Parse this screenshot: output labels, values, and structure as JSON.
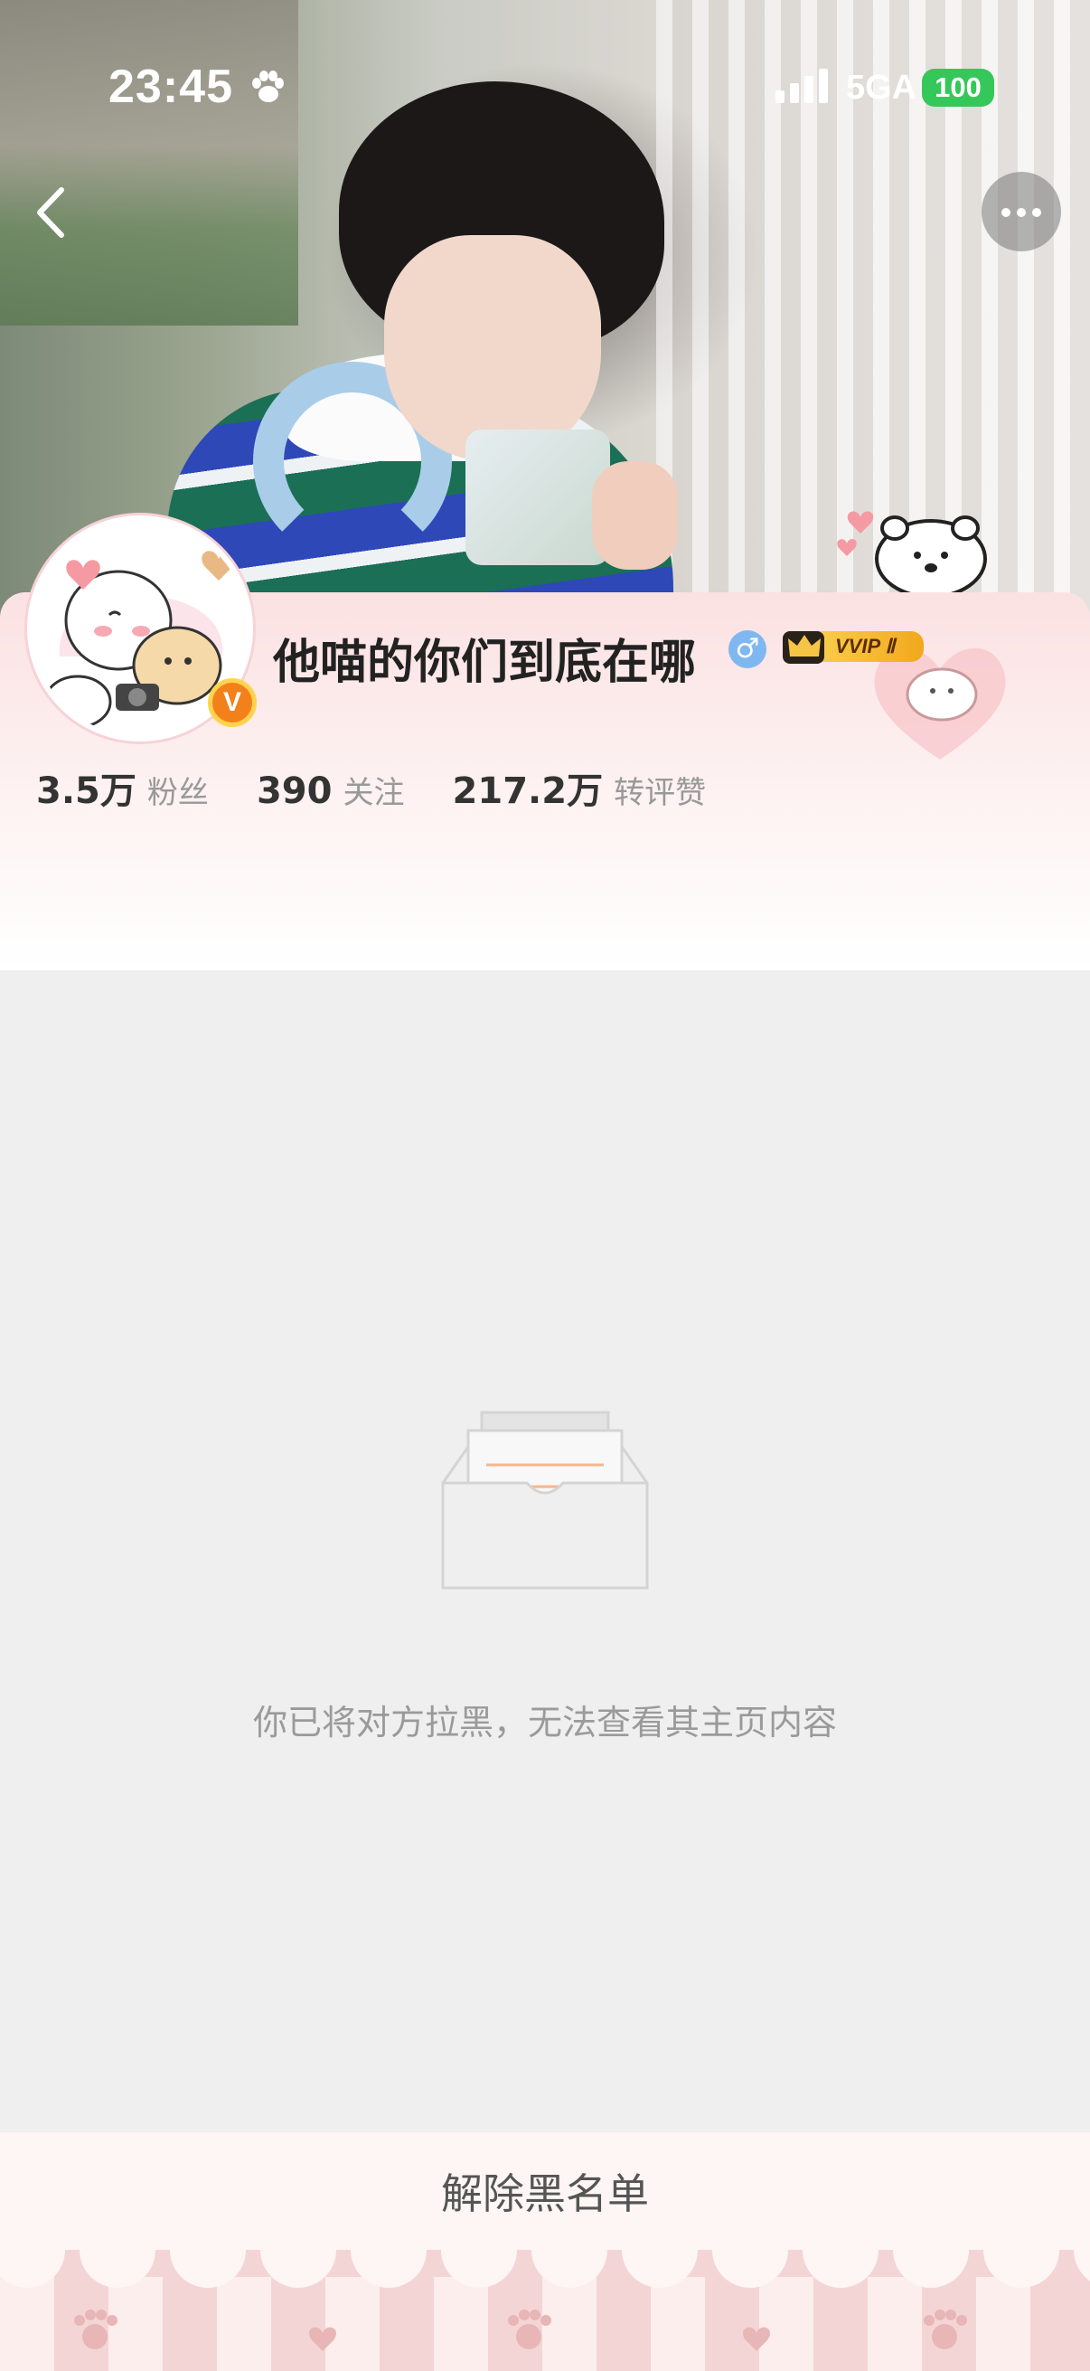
{
  "status_bar": {
    "time": "23:45",
    "network": "5GA",
    "battery": "100",
    "battery_color": "#35c759"
  },
  "header": {
    "back_icon": "chevron-left-icon",
    "more_icon": "more-dots-icon"
  },
  "profile": {
    "username": "他喵的你们到底在哪",
    "gender_icon": "male-icon",
    "gender_symbol": "♂",
    "verified_badge": "V",
    "vip_label": "VVIP Ⅱ",
    "vip_icon": "crown-icon"
  },
  "stats": [
    {
      "value": "3.5万",
      "label": "粉丝"
    },
    {
      "value": "390",
      "label": "关注"
    },
    {
      "value": "217.2万",
      "label": "转评赞"
    }
  ],
  "blocked": {
    "icon": "empty-inbox-icon",
    "message": "你已将对方拉黑，无法查看其主页内容"
  },
  "footer": {
    "unblock_label": "解除黑名单"
  },
  "colors": {
    "card_pink": "#fbe1e2",
    "verified_orange": "#f2811c",
    "vip_gold": "#f9cf4e",
    "page_bg": "#efefef"
  }
}
